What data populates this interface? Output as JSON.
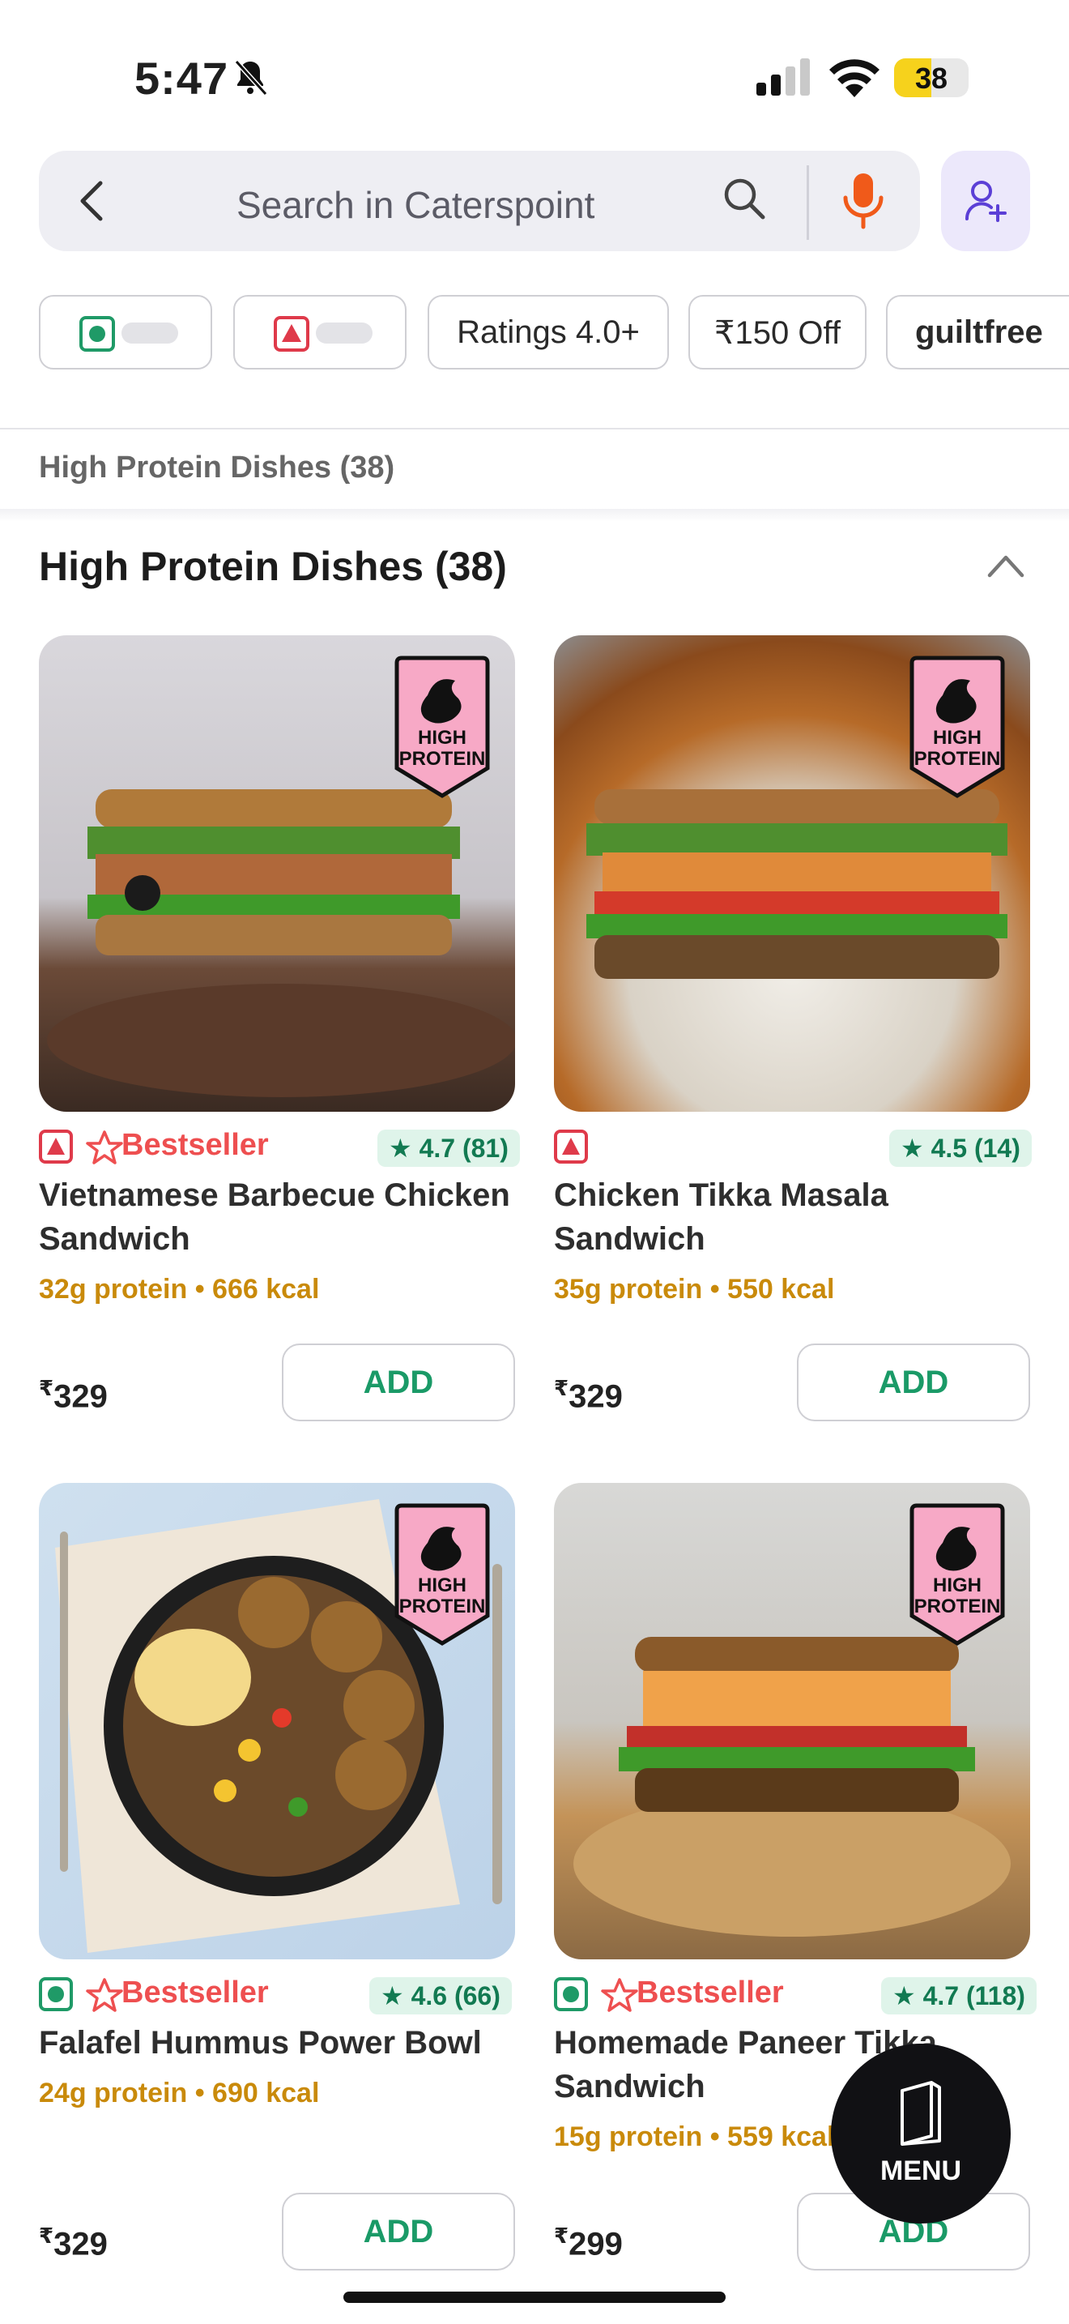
{
  "status_bar": {
    "time": "5:47",
    "battery": "38"
  },
  "search": {
    "placeholder": "Search in Caterspoint"
  },
  "filters": [
    {
      "label": ""
    },
    {
      "label": ""
    },
    {
      "label": "Ratings 4.0+"
    },
    {
      "label": "₹150 Off"
    },
    {
      "label": "guiltfree"
    }
  ],
  "section": {
    "tag": "High Protein Dishes (38)",
    "title": "High Protein Dishes (38)"
  },
  "badge": {
    "line1": "HIGH",
    "line2": "PROTEIN"
  },
  "dishes": [
    {
      "name_line1": "Vietnamese Barbecue Chicken",
      "name_line2": "Sandwich",
      "meta": "32g protein • 666 kcal",
      "price": "329",
      "rating": "4.7 (81)",
      "bestseller": "Bestseller",
      "diet": "non-veg",
      "add": "ADD"
    },
    {
      "name_line1": "Chicken Tikka Masala",
      "name_line2": "Sandwich",
      "meta": "35g protein • 550 kcal",
      "price": "329",
      "rating": "4.5 (14)",
      "bestseller": "",
      "diet": "non-veg",
      "add": "ADD"
    },
    {
      "name_line1": "Falafel Hummus Power Bowl",
      "name_line2": "",
      "meta": "24g protein • 690 kcal",
      "price": "329",
      "rating": "4.6 (66)",
      "bestseller": "Bestseller",
      "diet": "veg",
      "add": "ADD"
    },
    {
      "name_line1": "Homemade Paneer Tikka",
      "name_line2": "Sandwich",
      "meta": "15g protein • 559 kcal",
      "price": "299",
      "rating": "4.7 (118)",
      "bestseller": "Bestseller",
      "diet": "veg",
      "add": "ADD"
    }
  ],
  "currency": "₹",
  "fab": {
    "label": "MENU"
  },
  "colors": {
    "veg": "#1f9a67",
    "non_veg": "#df3a4a",
    "accent_orange": "#f05a1a",
    "bestseller": "#ee4f50"
  }
}
